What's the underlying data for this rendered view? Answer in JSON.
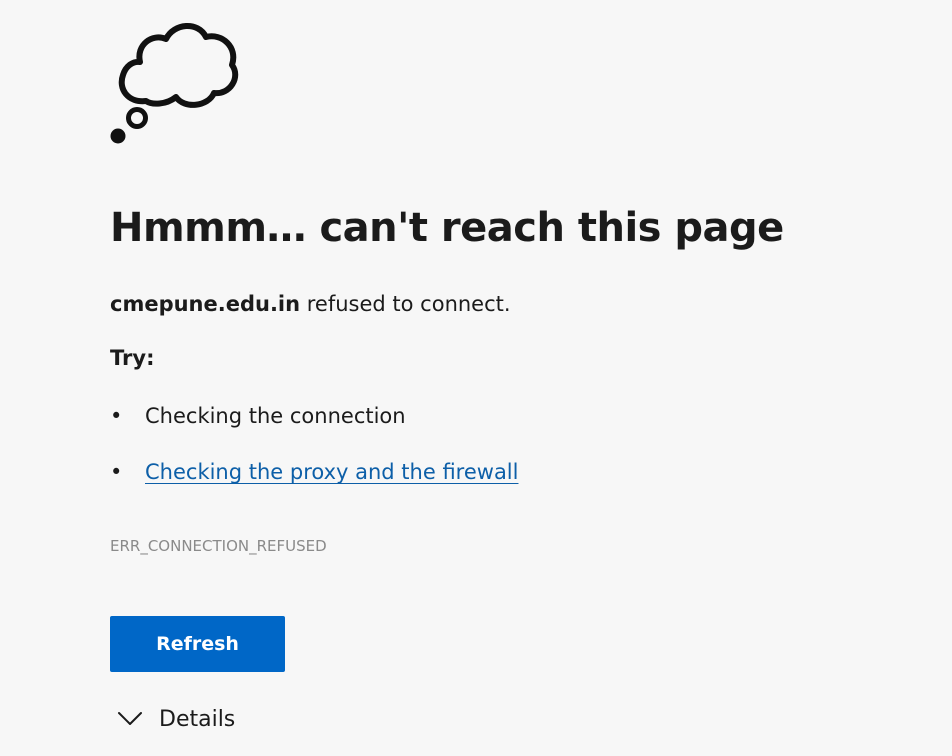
{
  "main": {
    "icon": "thought-cloud-icon",
    "title": "Hmmm… can't reach this page",
    "message_host": "cmepune.edu.in",
    "message_text": " refused to connect.",
    "try_label": "Try:",
    "suggestions": [
      {
        "bullet": "•",
        "label": "Checking the connection"
      },
      {
        "bullet": "•",
        "label": "Checking the proxy and the firewall",
        "is_link": true
      }
    ],
    "error_code": "ERR_CONNECTION_REFUSED",
    "refresh_label": "Refresh",
    "details_label": "Details",
    "details_icon": "chevron-down-icon"
  },
  "colors": {
    "background": "#f7f7f7",
    "text": "#1b1b1b",
    "link": "#0d5fa8",
    "button": "#0067c7",
    "error_code": "#8a8a8a"
  }
}
